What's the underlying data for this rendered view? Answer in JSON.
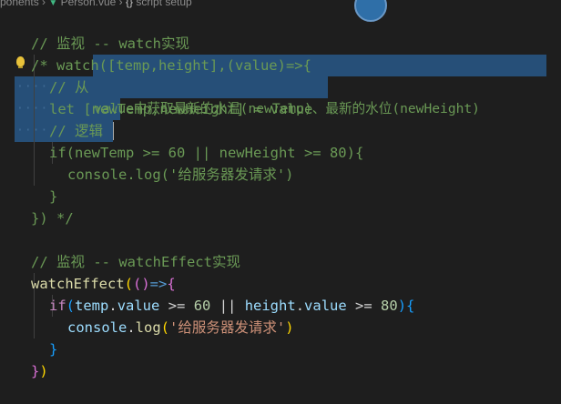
{
  "breadcrumb": {
    "path": "ponents › ",
    "file": "Person.vue",
    "sep": " › ",
    "scope": "script setup"
  },
  "code": {
    "line1": "// 监视 -- watch实现",
    "line2_a": "/* watch([temp,height],(value)=>{",
    "line3_a": "// 从",
    "line3_b": "value中获取最新的水温(newTemp)、最新的水位(newHeight)",
    "line4": "let [newTemp,newHeight] = value",
    "line5": "// 逻辑",
    "line6": "if(newTemp >= 60 || newHeight >= 80){",
    "line7": "console.log('给服务器发请求')",
    "line8": "}",
    "line9": "}) */",
    "line11": "// 监视 -- watchEffect实现",
    "line12_func": "watchEffect",
    "line12_p1": "(",
    "line12_p2": "()",
    "line12_arrow": "=>",
    "line12_brace": "{",
    "line13_if": "if",
    "line13_paren": "(",
    "line13_temp": "temp",
    "line13_dot1": ".",
    "line13_value1": "value",
    "line13_gte1": " >= ",
    "line13_num1": "60",
    "line13_or": " || ",
    "line13_height": "height",
    "line13_dot2": ".",
    "line13_value2": "value",
    "line13_gte2": " >= ",
    "line13_num2": "80",
    "line13_close": ")",
    "line13_brace": "{",
    "line14_console": "console",
    "line14_dot": ".",
    "line14_log": "log",
    "line14_open": "(",
    "line14_str": "'给服务器发请求'",
    "line14_close": ")",
    "line15": "}",
    "line16_brace": "}",
    "line16_paren": ")"
  },
  "icons": {
    "vue": "vue-file-icon",
    "scope": "braces-icon",
    "lightbulb": "lightbulb-icon"
  },
  "colors": {
    "background": "#1e1e1e",
    "selection": "#264f78",
    "comment": "#6a9955",
    "keyword": "#569cd6",
    "control": "#c586c0",
    "function": "#dcdcaa",
    "variable": "#9cdcfe",
    "number": "#b5cea8",
    "string": "#ce9178"
  }
}
